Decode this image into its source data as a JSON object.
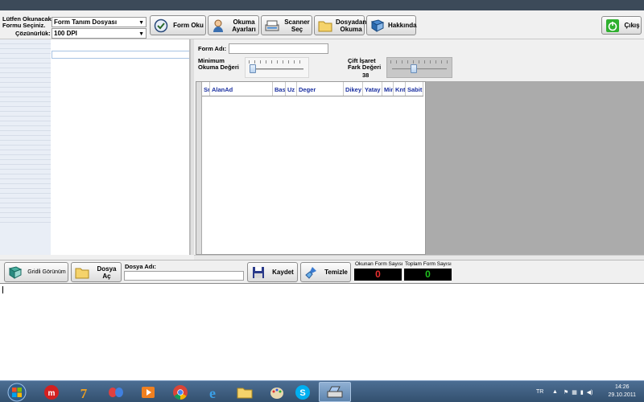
{
  "window": {
    "exit_label": "Çıkış"
  },
  "form_select": {
    "label_line1": "Lütfen Okunacak",
    "label_line2": "Formu Seçiniz.",
    "value": "Form Tanım Dosyası",
    "resolution_label": "Çözünürlük:",
    "resolution_value": "100 DPI"
  },
  "toolbar": {
    "form_oku": "Form Oku",
    "okuma_ayarlari_line1": "Okuma",
    "okuma_ayarlari_line2": "Ayarları",
    "scanner_sec_line1": "Scanner",
    "scanner_sec_line2": "Seç",
    "dosyadan_okuma_line1": "Dosyadan",
    "dosyadan_okuma_line2": "Okuma",
    "hakkinda": "Hakkında"
  },
  "settings": {
    "form_adi_label": "Form Adı:",
    "form_adi_value": "",
    "min_okuma_line1": "Minimum",
    "min_okuma_line2": "Okuma Değeri",
    "min_okuma_level": 0.02,
    "cift_isaret_line1": "Çift İşaret",
    "cift_isaret_line2": "Fark Değeri",
    "cift_isaret_value": "38",
    "cift_isaret_level": 0.38
  },
  "grid": {
    "columns": [
      "Sr",
      "AlanAd",
      "Bas",
      "Uz",
      "Deger",
      "Dikey",
      "Yatay",
      "Min",
      "Knt",
      "Sabit"
    ],
    "rows": []
  },
  "bottom": {
    "gridli_gorunum": "Gridli Görünüm",
    "dosya_ac": "Dosya Aç",
    "dosya_adi_label": "Dosya Adı:",
    "dosya_adi_value": "",
    "kaydet": "Kaydet",
    "temizle": "Temizle",
    "okunan_form_label": "Okunan Form Sayısı",
    "okunan_form_value": "0",
    "toplam_form_label": "Toplam Form Sayısı",
    "toplam_form_value": "0"
  },
  "taskbar": {
    "language": "TR",
    "time": "14:26",
    "date": "29.10.2011"
  },
  "colors": {
    "counter_red": "#e83030",
    "counter_green": "#20c020",
    "grid_header_text": "#1a2fa0"
  }
}
